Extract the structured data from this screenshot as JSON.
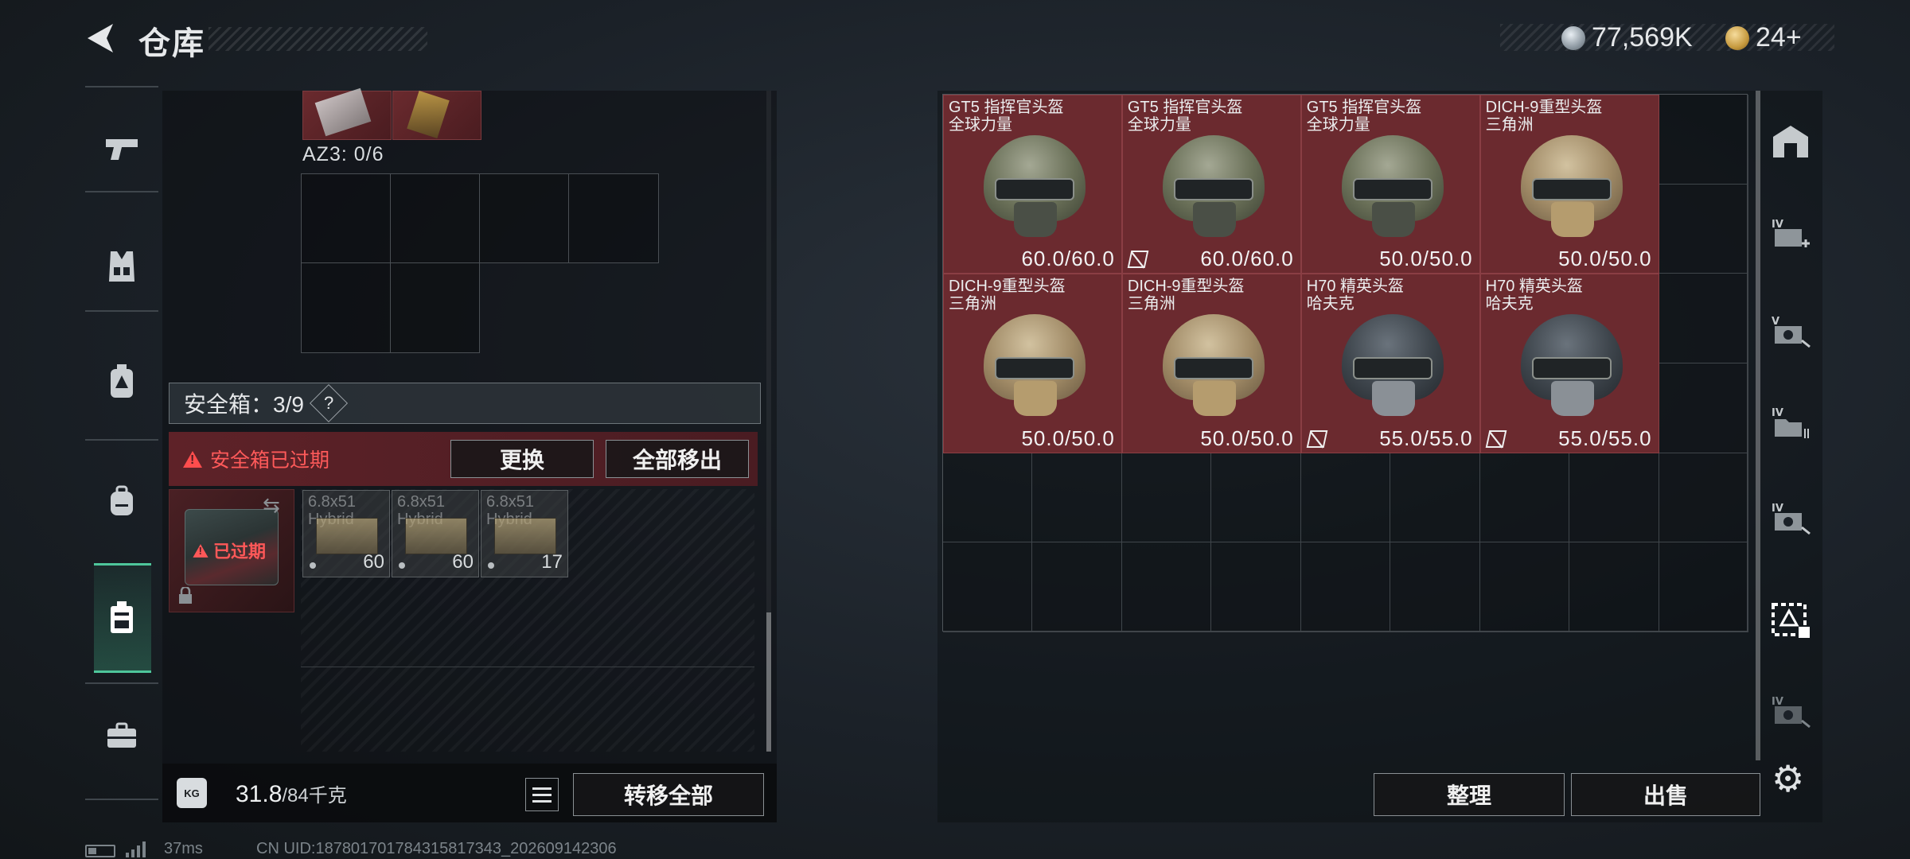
{
  "header": {
    "title": "仓库",
    "currency_silver": "77,569K",
    "currency_gold": "24+"
  },
  "nav": {
    "items": [
      "weapon-icon",
      "vest-icon",
      "backpack-armor-icon",
      "backpack-icon",
      "safebox-icon",
      "toolbox-icon"
    ],
    "active_index": 4
  },
  "left": {
    "az3_label": "AZ3: 0/6",
    "safebox_label": "安全箱：3/9",
    "help_mark": "?",
    "expired_notice": "安全箱已过期",
    "replace_button": "更换",
    "move_all_out_button": "全部移出",
    "box_expired_label": "已过期",
    "ammo": [
      {
        "caliber": "6.8x51",
        "type": "Hybrid",
        "count": "60"
      },
      {
        "caliber": "6.8x51",
        "type": "Hybrid",
        "count": "60"
      },
      {
        "caliber": "6.8x51",
        "type": "Hybrid",
        "count": "17"
      }
    ],
    "weight_current": "31.8",
    "weight_max": "/84千克",
    "weight_icon_text": "KG",
    "transfer_all_button": "转移全部"
  },
  "right": {
    "helmets": [
      {
        "name": "GT5 指挥官头盔",
        "maker": "全球力量",
        "durability": "60.0/60.0",
        "no_trade": false,
        "style": "gt5"
      },
      {
        "name": "GT5 指挥官头盔",
        "maker": "全球力量",
        "durability": "60.0/60.0",
        "no_trade": true,
        "style": "gt5"
      },
      {
        "name": "GT5 指挥官头盔",
        "maker": "全球力量",
        "durability": "50.0/50.0",
        "no_trade": false,
        "style": "gt5"
      },
      {
        "name": "DICH-9重型头盔",
        "maker": "三角洲",
        "durability": "50.0/50.0",
        "no_trade": false,
        "style": "dich"
      },
      {
        "name": "DICH-9重型头盔",
        "maker": "三角洲",
        "durability": "50.0/50.0",
        "no_trade": false,
        "style": "dich"
      },
      {
        "name": "DICH-9重型头盔",
        "maker": "三角洲",
        "durability": "50.0/50.0",
        "no_trade": false,
        "style": "dich"
      },
      {
        "name": "H70 精英头盔",
        "maker": "哈夫克",
        "durability": "55.0/55.0",
        "no_trade": true,
        "style": "h70"
      },
      {
        "name": "H70 精英头盔",
        "maker": "哈夫克",
        "durability": "55.0/55.0",
        "no_trade": true,
        "style": "h70"
      }
    ],
    "sort_button": "整理",
    "sell_button": "出售",
    "side_tabs": [
      "home-icon",
      "IV",
      "V",
      "IV",
      "IV",
      "active-warehouse-icon",
      "IV"
    ]
  },
  "footer": {
    "ping": "37ms",
    "uid": "CN UID:187801701784315817343_202609142306"
  },
  "colors": {
    "accent_green": "#4ec69b",
    "item_red": "#6b2a2f",
    "warning_red": "#ff5a5a"
  }
}
